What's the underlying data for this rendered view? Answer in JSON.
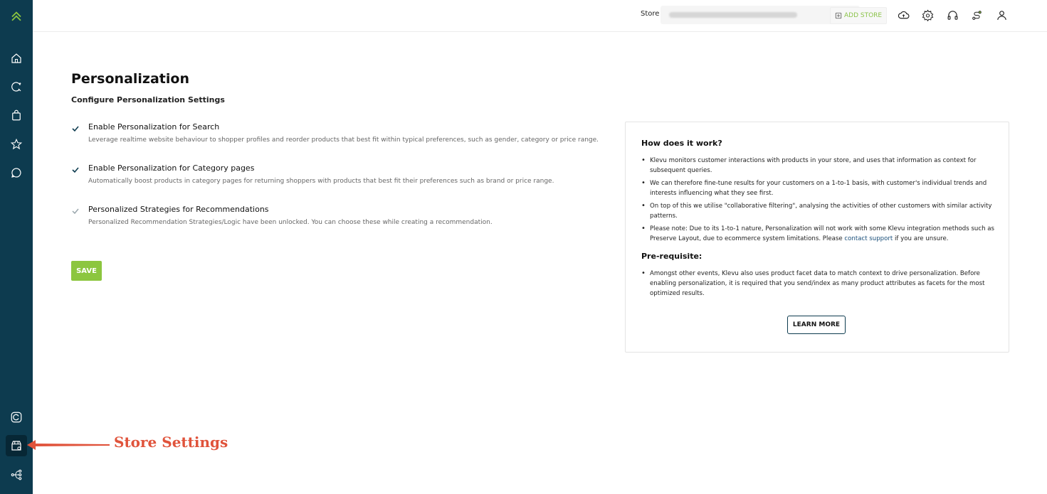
{
  "topbar": {
    "store_label": "Store",
    "store_value": "",
    "add_store_label": "ADD STORE",
    "icons": [
      "cloud-sync-icon",
      "settings-gear-icon",
      "headset-icon",
      "route-icon",
      "user-icon"
    ]
  },
  "sidebar": {
    "icons": [
      "logo-icon",
      "home-icon",
      "analytics-icon",
      "shopping-bag-icon",
      "star-icon",
      "chat-icon",
      "refresh-icon",
      "store-settings-icon",
      "integration-icon"
    ],
    "accent": "#8cc63f",
    "background": "#0d3b4f"
  },
  "main": {
    "title": "Personalization",
    "subtitle": "Configure Personalization Settings",
    "options": [
      {
        "label": "Enable Personalization for Search",
        "description": "Leverage realtime website behaviour to shopper profiles and reorder products that best fit within typical preferences, such as gender, category or price range.",
        "checked": true
      },
      {
        "label": "Enable Personalization for Category pages",
        "description": "Automatically boost products in category pages for returning shoppers with products that best fit their preferences such as brand or price range.",
        "checked": true
      },
      {
        "label": "Personalized Strategies for Recommendations",
        "description": "Personalized Recommendation Strategies/Logic have been unlocked. You can choose these while creating a recommendation.",
        "checked": true
      }
    ],
    "save_label": "SAVE"
  },
  "info": {
    "how_title": "How does it work?",
    "how_items": [
      "Klevu monitors customer interactions with products in your store, and uses that information as context for subsequent queries.",
      "We can therefore fine-tune results for your customers on a 1-to-1 basis, with customer's individual trends and interests influencing what they see first.",
      "On top of this we utilise \"collaborative filtering\", analysing the activities of other customers with similar activity patterns."
    ],
    "note_prefix": "Please note: Due to its 1-to-1 nature, Personalization will not work with some Klevu integration methods such as Preserve Layout, due to ecommerce system limitations. Please ",
    "note_link": "contact support",
    "note_suffix": " if you are unsure.",
    "prereq_title": "Pre-requisite:",
    "prereq_items": [
      "Amongst other events, Klevu also uses product facet data to match context to drive personalization. Before enabling personalization, it is required that you send/index as many product attributes as facets for the most optimized results."
    ],
    "learn_more_label": "LEARN MORE"
  },
  "annotation": {
    "text": "Store Settings",
    "color": "#e0533b"
  }
}
